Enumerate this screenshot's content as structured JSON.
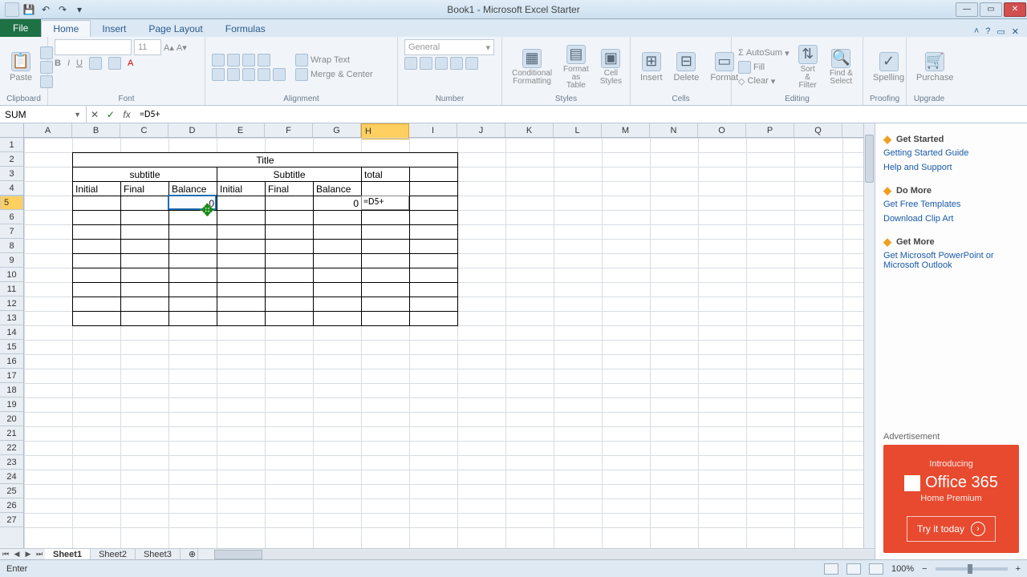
{
  "app": {
    "title": "Book1 - Microsoft Excel Starter"
  },
  "qat": {
    "save": "💾",
    "undo": "↶",
    "redo": "↷",
    "more": "▾"
  },
  "win": {
    "min": "—",
    "max": "▭",
    "close": "✕"
  },
  "tabs": {
    "file": "File",
    "list": [
      "Home",
      "Insert",
      "Page Layout",
      "Formulas"
    ],
    "active": "Home"
  },
  "help": {
    "min": "˄",
    "q": "?",
    "opts": "▭",
    "x": "✕"
  },
  "ribbon": {
    "clipboard": {
      "paste": "Paste",
      "label": "Clipboard"
    },
    "font": {
      "name": "",
      "size": "11",
      "label": "Font",
      "bold": "B",
      "italic": "I",
      "underline": "U"
    },
    "alignment": {
      "wrap": "Wrap Text",
      "merge": "Merge & Center",
      "label": "Alignment"
    },
    "number": {
      "format": "General",
      "label": "Number"
    },
    "styles": {
      "cond": "Conditional Formatting",
      "table": "Format as Table",
      "cell": "Cell Styles",
      "label": "Styles"
    },
    "cells": {
      "insert": "Insert",
      "delete": "Delete",
      "format": "Format",
      "label": "Cells"
    },
    "editing": {
      "autosum": "AutoSum",
      "fill": "Fill",
      "clear": "Clear",
      "sort": "Sort & Filter",
      "find": "Find & Select",
      "label": "Editing"
    },
    "proofing": {
      "spelling": "Spelling",
      "label": "Proofing"
    },
    "upgrade": {
      "purchase": "Purchase",
      "label": "Upgrade"
    }
  },
  "fbar": {
    "name": "SUM",
    "cancel": "✕",
    "enter": "✓",
    "fx": "fx",
    "formula": "=D5+"
  },
  "columns": [
    "A",
    "B",
    "C",
    "D",
    "E",
    "F",
    "G",
    "H",
    "I",
    "J",
    "K",
    "L",
    "M",
    "N",
    "O",
    "P",
    "Q"
  ],
  "rows_count": 27,
  "selected_col": "H",
  "selected_row": 5,
  "table": {
    "start_col": 1,
    "start_row": 1,
    "title": "Title",
    "sub1": "subtitle",
    "sub2": "Subtitle",
    "total": "total",
    "h": [
      "Initial",
      "Final",
      "Balance",
      "Initial",
      "Final",
      "Balance"
    ],
    "d5": "0",
    "g5": "0",
    "h5": "=D5+"
  },
  "sheets": {
    "nav": [
      "⏮",
      "◀",
      "▶",
      "⏭"
    ],
    "list": [
      "Sheet1",
      "Sheet2",
      "Sheet3"
    ],
    "active": "Sheet1",
    "new": "⊕"
  },
  "side": {
    "get_started": {
      "title": "Get Started",
      "links": [
        "Getting Started Guide",
        "Help and Support"
      ],
      "bullet": "◆"
    },
    "do_more": {
      "title": "Do More",
      "links": [
        "Get Free Templates",
        "Download Clip Art"
      ],
      "bullet": "◆"
    },
    "get_more": {
      "title": "Get More",
      "links": [
        "Get Microsoft PowerPoint or Microsoft Outlook"
      ],
      "bullet": "◆"
    },
    "ad": {
      "label": "Advertisement",
      "intro": "Introducing",
      "product": "Office 365",
      "sub": "Home Premium",
      "cta": "Try it today"
    }
  },
  "status": {
    "mode": "Enter",
    "zoom": "100%",
    "minus": "−",
    "plus": "+"
  }
}
